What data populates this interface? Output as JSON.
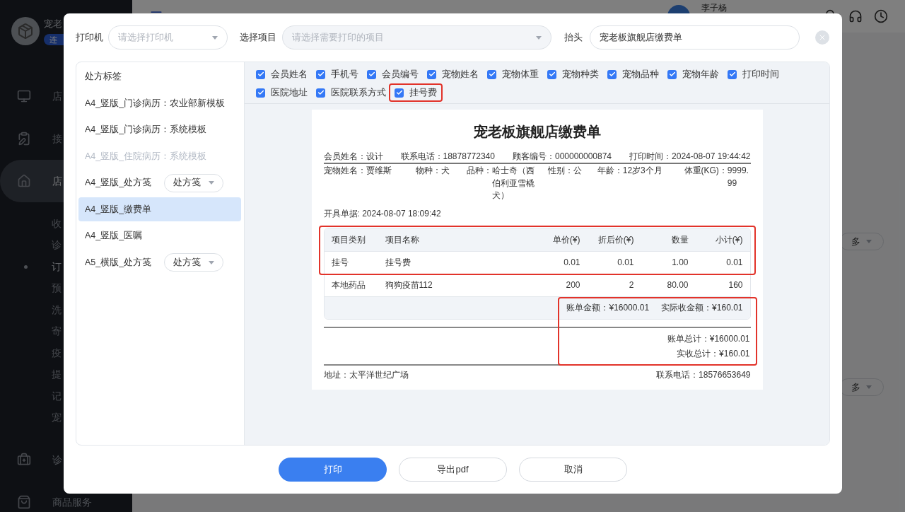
{
  "background": {
    "brand": "宠老",
    "badge": "连",
    "nav": [
      {
        "label": "店",
        "selected": false
      },
      {
        "label": "接",
        "selected": false
      },
      {
        "label": "店",
        "selected": true
      }
    ],
    "subnav": [
      {
        "label": "收",
        "selected": false
      },
      {
        "label": "诊",
        "selected": false
      },
      {
        "label": "订",
        "selected": true
      },
      {
        "label": "预",
        "selected": false
      },
      {
        "label": "洗",
        "selected": false
      },
      {
        "label": "寄",
        "selected": false
      },
      {
        "label": "疫",
        "selected": false
      },
      {
        "label": "提",
        "selected": false
      },
      {
        "label": "记",
        "selected": false
      },
      {
        "label": "宠",
        "selected": false
      }
    ],
    "nav_bottom": [
      {
        "label": "诊"
      },
      {
        "label": "商品服务"
      }
    ],
    "user": "李子杨",
    "more_buttons": [
      "多",
      "多"
    ]
  },
  "dialog": {
    "printer": {
      "label": "打印机",
      "placeholder": "请选择打印机"
    },
    "items_select": {
      "label": "选择项目",
      "placeholder": "请选择需要打印的项目"
    },
    "header_field": {
      "label": "抬头",
      "value": "宠老板旗舰店缴费单"
    },
    "templates": [
      {
        "label": "处方标签",
        "selected": false,
        "disabled": false
      },
      {
        "label": "A4_竖版_门诊病历：农业部新模板",
        "selected": false,
        "disabled": false
      },
      {
        "label": "A4_竖版_门诊病历：系统模板",
        "selected": false,
        "disabled": false
      },
      {
        "label": "A4_竖版_住院病历：系统模板",
        "selected": false,
        "disabled": true
      },
      {
        "label": "A4_竖版_处方笺",
        "selected": false,
        "disabled": false,
        "dropdown": "处方笺"
      },
      {
        "label": "A4_竖版_缴费单",
        "selected": true,
        "disabled": false
      },
      {
        "label": "A4_竖版_医嘱",
        "selected": false,
        "disabled": false
      },
      {
        "label": "A5_横版_处方笺",
        "selected": false,
        "disabled": false,
        "dropdown": "处方笺"
      }
    ],
    "fields": [
      {
        "label": "会员姓名",
        "checked": true,
        "highlighted": false
      },
      {
        "label": "手机号",
        "checked": true,
        "highlighted": false
      },
      {
        "label": "会员编号",
        "checked": true,
        "highlighted": false
      },
      {
        "label": "宠物姓名",
        "checked": true,
        "highlighted": false
      },
      {
        "label": "宠物体重",
        "checked": true,
        "highlighted": false
      },
      {
        "label": "宠物种类",
        "checked": true,
        "highlighted": false
      },
      {
        "label": "宠物品种",
        "checked": true,
        "highlighted": false
      },
      {
        "label": "宠物年龄",
        "checked": true,
        "highlighted": false
      },
      {
        "label": "打印时间",
        "checked": true,
        "highlighted": false
      },
      {
        "label": "医院地址",
        "checked": true,
        "highlighted": false
      },
      {
        "label": "医院联系方式",
        "checked": true,
        "highlighted": false
      },
      {
        "label": "挂号费",
        "checked": true,
        "highlighted": true
      }
    ],
    "receipt": {
      "title": "宠老板旗舰店缴费单",
      "info_row_1": [
        {
          "label": "会员姓名：",
          "value": "设计"
        },
        {
          "label": "联系电话：",
          "value": "18878772340"
        },
        {
          "label": "顾客编号：",
          "value": "000000000874"
        },
        {
          "label": "打印时间：",
          "value": "2024-08-07 19:44:42"
        }
      ],
      "info_row_2": [
        {
          "label": "宠物姓名：",
          "value": "贾维斯"
        },
        {
          "label": "物种：",
          "value": "犬"
        },
        {
          "label": "品种：",
          "value": "哈士奇（西伯利亚雪橇犬）"
        },
        {
          "label": "性别：",
          "value": "公"
        },
        {
          "label": "年龄：",
          "value": "12岁3个月"
        },
        {
          "label": "体重(KG)：",
          "value": "9999.99"
        }
      ],
      "issued": "开具单据: 2024-08-07 18:09:42",
      "table": {
        "columns": [
          "项目类别",
          "项目名称",
          "单价(¥)",
          "折后价(¥)",
          "数量",
          "小计(¥)"
        ],
        "header_and_first_row_highlighted": true,
        "rows": [
          {
            "cells": [
              "挂号",
              "挂号费",
              "0.01",
              "0.01",
              "1.00",
              "0.01"
            ]
          },
          {
            "cells": [
              "本地药品",
              "狗狗疫苗112",
              "200",
              "2",
              "80.00",
              "160"
            ]
          }
        ],
        "summary": [
          "账单金额：¥16000.01",
          "实际收金额：¥160.01"
        ]
      },
      "totals": [
        "账单总计：¥16000.01",
        "实收总计：¥160.01"
      ],
      "totals_highlighted": true,
      "address": "地址：太平洋世纪广场",
      "phone": "联系电话：18576653649"
    },
    "buttons": [
      {
        "label": "打印",
        "kind": "primary"
      },
      {
        "label": "导出pdf",
        "kind": "default"
      },
      {
        "label": "取消",
        "kind": "default"
      }
    ]
  }
}
